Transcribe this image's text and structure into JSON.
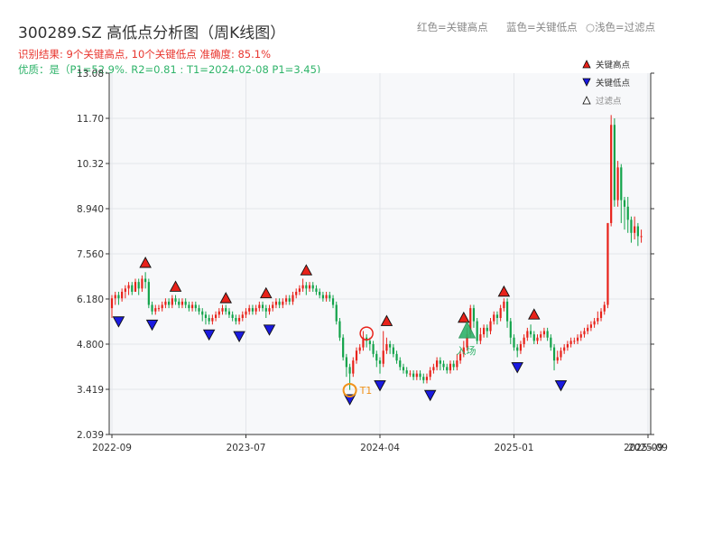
{
  "chart_data": {
    "type": "candlestick",
    "title": "300289.SZ 高低点分析图（周K线图）",
    "result_text": "识别结果: 9个关键高点, 10个关键低点  准确度: 85.1%",
    "quality_text": "优质：是（P1=52.9%, R2=0.81 ; T1=2024-02-08 P1=3.45)",
    "top_legend": [
      "红色=关键高点",
      "蓝色=关键低点",
      "○浅色=过滤点"
    ],
    "legend": [
      "关键高点",
      "关键低点",
      "过滤点"
    ],
    "ylim": [
      2.039,
      13.08
    ],
    "yticks": [
      "2.039",
      "3.419",
      "4.800",
      "6.180",
      "7.560",
      "8.940",
      "10.32",
      "11.70",
      "13.08"
    ],
    "xticks": [
      "2022-09",
      "2023-07",
      "2024-04",
      "2025-01",
      "2025-09"
    ],
    "xtick_overlap_label": "2025-09",
    "xlim": [
      0,
      160
    ],
    "xtick_positions": [
      0,
      40,
      80,
      120,
      160
    ],
    "key_highs": [
      {
        "x": 10,
        "y": 6.98
      },
      {
        "x": 19,
        "y": 6.25
      },
      {
        "x": 34,
        "y": 5.9
      },
      {
        "x": 46,
        "y": 6.05
      },
      {
        "x": 58,
        "y": 6.75
      },
      {
        "x": 82,
        "y": 5.2
      },
      {
        "x": 105,
        "y": 5.3
      },
      {
        "x": 117,
        "y": 6.1
      },
      {
        "x": 126,
        "y": 5.4
      }
    ],
    "key_lows": [
      {
        "x": 2,
        "y": 5.8
      },
      {
        "x": 12,
        "y": 5.7
      },
      {
        "x": 29,
        "y": 5.4
      },
      {
        "x": 38,
        "y": 5.35
      },
      {
        "x": 47,
        "y": 5.55
      },
      {
        "x": 71,
        "y": 3.42
      },
      {
        "x": 80,
        "y": 3.85
      },
      {
        "x": 95,
        "y": 3.55
      },
      {
        "x": 121,
        "y": 4.4
      },
      {
        "x": 134,
        "y": 3.85
      }
    ],
    "filtered_highs": [],
    "t1_marker": {
      "x": 71,
      "y": 3.42,
      "label": "T1"
    },
    "circle_high": {
      "x": 76,
      "y": 5.1
    },
    "entry_marker": {
      "x": 106,
      "y": 5.1,
      "label": "入场"
    },
    "candles": [
      [
        5.9,
        6.2,
        6.3,
        5.6
      ],
      [
        6.2,
        6.3,
        6.4,
        6.0
      ],
      [
        6.3,
        6.2,
        6.4,
        6.0
      ],
      [
        6.2,
        6.4,
        6.5,
        6.1
      ],
      [
        6.4,
        6.5,
        6.6,
        6.2
      ],
      [
        6.5,
        6.6,
        6.7,
        6.3
      ],
      [
        6.6,
        6.4,
        6.7,
        6.3
      ],
      [
        6.4,
        6.7,
        6.8,
        6.4
      ],
      [
        6.7,
        6.5,
        6.8,
        6.3
      ],
      [
        6.5,
        6.8,
        6.9,
        6.4
      ],
      [
        6.8,
        6.7,
        7.0,
        6.5
      ],
      [
        6.7,
        6.0,
        6.8,
        5.9
      ],
      [
        6.0,
        5.8,
        6.1,
        5.7
      ],
      [
        5.8,
        5.9,
        6.0,
        5.7
      ],
      [
        5.9,
        5.9,
        6.0,
        5.8
      ],
      [
        5.9,
        6.0,
        6.1,
        5.8
      ],
      [
        6.0,
        6.1,
        6.2,
        5.9
      ],
      [
        6.1,
        6.0,
        6.2,
        5.9
      ],
      [
        6.0,
        6.2,
        6.3,
        5.9
      ],
      [
        6.2,
        6.1,
        6.3,
        6.0
      ],
      [
        6.1,
        6.0,
        6.2,
        5.9
      ],
      [
        6.0,
        6.1,
        6.2,
        5.9
      ],
      [
        6.1,
        6.0,
        6.2,
        5.9
      ],
      [
        6.0,
        5.9,
        6.1,
        5.8
      ],
      [
        5.9,
        6.0,
        6.1,
        5.8
      ],
      [
        6.0,
        5.9,
        6.1,
        5.8
      ],
      [
        5.9,
        5.8,
        6.0,
        5.7
      ],
      [
        5.8,
        5.7,
        5.9,
        5.5
      ],
      [
        5.7,
        5.6,
        5.8,
        5.4
      ],
      [
        5.6,
        5.5,
        5.7,
        5.4
      ],
      [
        5.5,
        5.6,
        5.7,
        5.4
      ],
      [
        5.6,
        5.7,
        5.8,
        5.5
      ],
      [
        5.7,
        5.8,
        5.9,
        5.6
      ],
      [
        5.8,
        5.9,
        6.0,
        5.7
      ],
      [
        5.9,
        5.8,
        6.0,
        5.7
      ],
      [
        5.8,
        5.7,
        5.9,
        5.6
      ],
      [
        5.7,
        5.6,
        5.8,
        5.5
      ],
      [
        5.6,
        5.5,
        5.7,
        5.4
      ],
      [
        5.5,
        5.6,
        5.7,
        5.4
      ],
      [
        5.6,
        5.7,
        5.8,
        5.5
      ],
      [
        5.7,
        5.8,
        5.9,
        5.6
      ],
      [
        5.8,
        5.9,
        6.0,
        5.7
      ],
      [
        5.9,
        5.8,
        6.0,
        5.7
      ],
      [
        5.8,
        5.9,
        6.0,
        5.7
      ],
      [
        5.9,
        6.0,
        6.1,
        5.8
      ],
      [
        6.0,
        5.9,
        6.1,
        5.8
      ],
      [
        5.9,
        5.8,
        6.0,
        5.6
      ],
      [
        5.8,
        5.9,
        6.0,
        5.7
      ],
      [
        5.9,
        6.0,
        6.1,
        5.8
      ],
      [
        6.0,
        6.1,
        6.2,
        5.9
      ],
      [
        6.1,
        6.0,
        6.2,
        5.9
      ],
      [
        6.0,
        6.1,
        6.2,
        5.9
      ],
      [
        6.1,
        6.2,
        6.3,
        6.0
      ],
      [
        6.2,
        6.1,
        6.3,
        6.0
      ],
      [
        6.1,
        6.3,
        6.4,
        6.0
      ],
      [
        6.3,
        6.4,
        6.5,
        6.2
      ],
      [
        6.4,
        6.5,
        6.6,
        6.3
      ],
      [
        6.5,
        6.6,
        6.8,
        6.4
      ],
      [
        6.6,
        6.5,
        6.7,
        6.3
      ],
      [
        6.5,
        6.6,
        6.7,
        6.4
      ],
      [
        6.6,
        6.5,
        6.7,
        6.4
      ],
      [
        6.5,
        6.4,
        6.6,
        6.3
      ],
      [
        6.4,
        6.3,
        6.5,
        6.2
      ],
      [
        6.3,
        6.2,
        6.4,
        6.1
      ],
      [
        6.2,
        6.3,
        6.4,
        6.1
      ],
      [
        6.3,
        6.2,
        6.4,
        6.1
      ],
      [
        6.2,
        6.0,
        6.3,
        5.9
      ],
      [
        6.0,
        5.5,
        6.1,
        5.4
      ],
      [
        5.5,
        5.0,
        5.6,
        4.9
      ],
      [
        5.0,
        4.4,
        5.1,
        4.3
      ],
      [
        4.4,
        4.1,
        4.5,
        3.8
      ],
      [
        4.1,
        3.9,
        4.2,
        3.4
      ],
      [
        3.9,
        4.3,
        4.4,
        3.8
      ],
      [
        4.3,
        4.6,
        4.7,
        4.2
      ],
      [
        4.6,
        4.7,
        4.8,
        4.5
      ],
      [
        4.7,
        5.0,
        5.2,
        4.6
      ],
      [
        5.0,
        4.9,
        5.1,
        4.7
      ],
      [
        4.9,
        4.8,
        5.0,
        4.6
      ],
      [
        4.8,
        4.5,
        4.9,
        4.4
      ],
      [
        4.5,
        4.3,
        4.6,
        4.1
      ],
      [
        4.3,
        4.2,
        4.4,
        3.9
      ],
      [
        4.2,
        4.6,
        5.2,
        4.1
      ],
      [
        4.6,
        4.8,
        5.0,
        4.5
      ],
      [
        4.8,
        4.7,
        4.9,
        4.5
      ],
      [
        4.7,
        4.5,
        4.8,
        4.4
      ],
      [
        4.5,
        4.3,
        4.6,
        4.2
      ],
      [
        4.3,
        4.1,
        4.4,
        4.0
      ],
      [
        4.1,
        4.0,
        4.2,
        3.9
      ],
      [
        4.0,
        3.9,
        4.1,
        3.8
      ],
      [
        3.9,
        3.9,
        4.0,
        3.8
      ],
      [
        3.9,
        3.8,
        4.0,
        3.7
      ],
      [
        3.8,
        3.9,
        4.0,
        3.7
      ],
      [
        3.9,
        3.8,
        4.0,
        3.7
      ],
      [
        3.8,
        3.7,
        3.9,
        3.6
      ],
      [
        3.7,
        3.8,
        3.9,
        3.6
      ],
      [
        3.8,
        4.0,
        4.1,
        3.7
      ],
      [
        4.0,
        4.1,
        4.2,
        3.9
      ],
      [
        4.1,
        4.3,
        4.4,
        4.0
      ],
      [
        4.3,
        4.2,
        4.4,
        4.0
      ],
      [
        4.2,
        4.1,
        4.3,
        4.0
      ],
      [
        4.1,
        4.0,
        4.2,
        3.9
      ],
      [
        4.0,
        4.2,
        4.3,
        3.9
      ],
      [
        4.2,
        4.1,
        4.3,
        4.0
      ],
      [
        4.1,
        4.3,
        4.5,
        4.0
      ],
      [
        4.3,
        4.5,
        4.6,
        4.2
      ],
      [
        4.5,
        4.7,
        4.9,
        4.4
      ],
      [
        4.7,
        5.1,
        5.3,
        4.6
      ],
      [
        5.1,
        5.9,
        6.0,
        5.0
      ],
      [
        5.9,
        5.5,
        6.0,
        5.3
      ],
      [
        5.5,
        4.9,
        5.6,
        4.8
      ],
      [
        4.9,
        5.1,
        5.3,
        4.8
      ],
      [
        5.1,
        5.3,
        5.4,
        5.0
      ],
      [
        5.3,
        5.2,
        5.4,
        5.0
      ],
      [
        5.2,
        5.5,
        5.6,
        5.1
      ],
      [
        5.5,
        5.7,
        5.8,
        5.4
      ],
      [
        5.7,
        5.6,
        5.8,
        5.4
      ],
      [
        5.6,
        5.9,
        6.0,
        5.5
      ],
      [
        5.9,
        6.1,
        6.2,
        5.8
      ],
      [
        6.1,
        5.5,
        6.2,
        5.3
      ],
      [
        5.5,
        5.0,
        5.6,
        4.8
      ],
      [
        5.0,
        4.7,
        5.1,
        4.6
      ],
      [
        4.7,
        4.6,
        4.8,
        4.4
      ],
      [
        4.6,
        4.8,
        4.9,
        4.5
      ],
      [
        4.8,
        5.0,
        5.1,
        4.7
      ],
      [
        5.0,
        5.2,
        5.3,
        4.9
      ],
      [
        5.2,
        5.1,
        5.4,
        5.0
      ],
      [
        5.1,
        4.9,
        5.2,
        4.8
      ],
      [
        4.9,
        5.0,
        5.1,
        4.8
      ],
      [
        5.0,
        5.1,
        5.2,
        4.9
      ],
      [
        5.1,
        5.2,
        5.3,
        5.0
      ],
      [
        5.2,
        5.0,
        5.3,
        4.9
      ],
      [
        5.0,
        4.7,
        5.1,
        4.6
      ],
      [
        4.7,
        4.3,
        4.8,
        4.0
      ],
      [
        4.3,
        4.4,
        4.6,
        4.2
      ],
      [
        4.4,
        4.6,
        4.7,
        4.3
      ],
      [
        4.6,
        4.7,
        4.8,
        4.5
      ],
      [
        4.7,
        4.8,
        4.9,
        4.6
      ],
      [
        4.8,
        4.9,
        5.0,
        4.7
      ],
      [
        4.9,
        4.9,
        5.0,
        4.8
      ],
      [
        4.9,
        5.0,
        5.1,
        4.8
      ],
      [
        5.0,
        5.1,
        5.2,
        4.9
      ],
      [
        5.1,
        5.2,
        5.3,
        5.0
      ],
      [
        5.2,
        5.3,
        5.4,
        5.1
      ],
      [
        5.3,
        5.4,
        5.5,
        5.2
      ],
      [
        5.4,
        5.5,
        5.6,
        5.3
      ],
      [
        5.5,
        5.6,
        5.8,
        5.4
      ],
      [
        5.6,
        5.8,
        5.9,
        5.5
      ],
      [
        5.8,
        6.0,
        6.1,
        5.7
      ],
      [
        6.0,
        8.5,
        8.5,
        5.9
      ],
      [
        8.5,
        11.5,
        11.8,
        8.4
      ],
      [
        11.5,
        9.2,
        11.7,
        9.0
      ],
      [
        9.2,
        10.2,
        10.4,
        9.0
      ],
      [
        10.2,
        9.2,
        10.3,
        8.5
      ],
      [
        9.2,
        9.0,
        9.3,
        8.3
      ],
      [
        9.0,
        8.6,
        9.3,
        8.2
      ],
      [
        8.6,
        8.2,
        8.7,
        7.9
      ],
      [
        8.2,
        8.4,
        8.7,
        8.0
      ],
      [
        8.4,
        8.1,
        8.5,
        7.8
      ],
      [
        8.1,
        8.1,
        8.3,
        7.9
      ]
    ]
  }
}
